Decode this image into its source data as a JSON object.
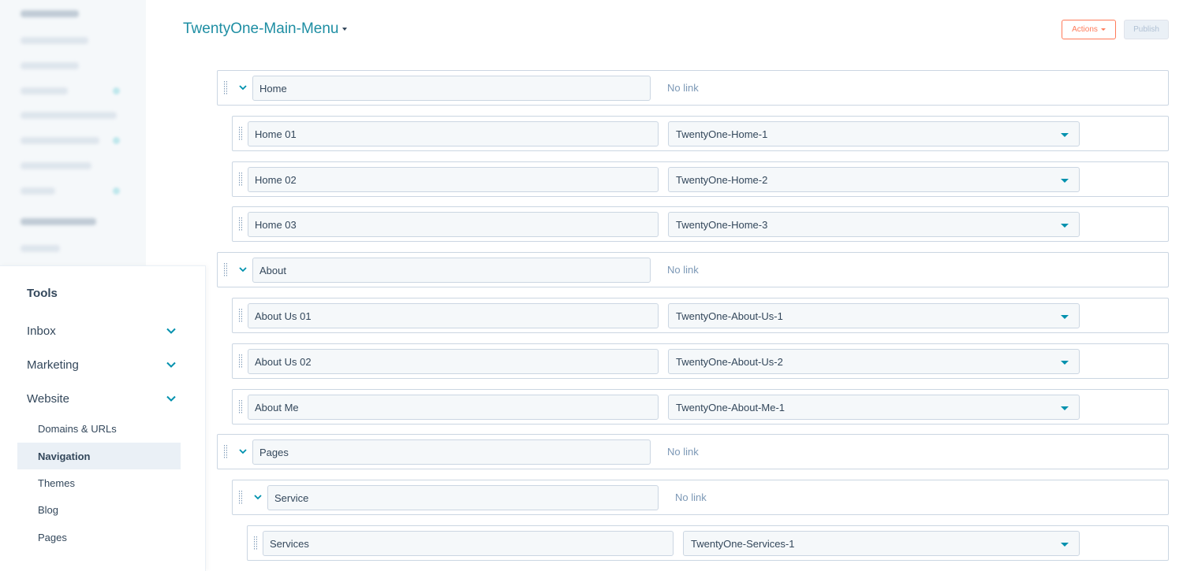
{
  "header": {
    "menu_title": "TwentyOne-Main-Menu",
    "actions_label": "Actions",
    "publish_label": "Publish"
  },
  "tools": {
    "title": "Tools",
    "sections": [
      "Inbox",
      "Marketing",
      "Website"
    ],
    "website_items": [
      "Domains & URLs",
      "Navigation",
      "Themes",
      "Blog",
      "Pages"
    ],
    "active_item": "Navigation"
  },
  "menu_items": [
    {
      "label": "Home",
      "link": "No link"
    },
    {
      "label": "Home 01",
      "link": "TwentyOne-Home-1"
    },
    {
      "label": "Home 02",
      "link": "TwentyOne-Home-2"
    },
    {
      "label": "Home 03",
      "link": "TwentyOne-Home-3"
    },
    {
      "label": "About",
      "link": "No link"
    },
    {
      "label": "About Us 01",
      "link": "TwentyOne-About-Us-1"
    },
    {
      "label": "About Us 02",
      "link": "TwentyOne-About-Us-2"
    },
    {
      "label": "About Me",
      "link": "TwentyOne-About-Me-1"
    },
    {
      "label": "Pages",
      "link": "No link"
    },
    {
      "label": "Service",
      "link": "No link"
    },
    {
      "label": "Services",
      "link": "TwentyOne-Services-1"
    }
  ],
  "colors": {
    "accent": "#1e8ea3",
    "actions": "#ff7a59",
    "border": "#cbd6e2",
    "muted": "#7c98b6"
  }
}
